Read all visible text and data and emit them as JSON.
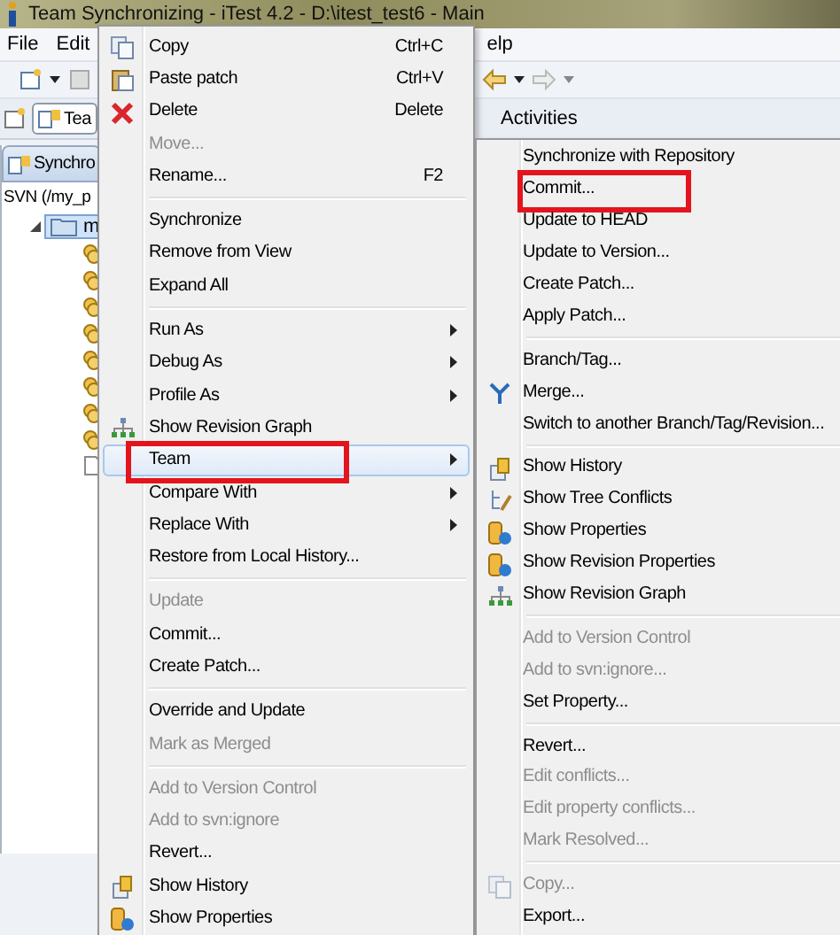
{
  "window": {
    "title": "Team Synchronizing - iTest 4.2 - D:\\itest_test6 - Main"
  },
  "menu_bar": [
    "File",
    "Edit",
    "elp"
  ],
  "perspective_bar": {
    "tab": "Tea",
    "label": "Activities"
  },
  "view": {
    "tab": "Synchro",
    "header": "SVN (/my_p",
    "tree": [
      {
        "kind": "folder",
        "label": "m",
        "expanded": true,
        "selected": true,
        "children": [
          {
            "kind": "package"
          },
          {
            "kind": "package"
          },
          {
            "kind": "package"
          },
          {
            "kind": "package"
          },
          {
            "kind": "package"
          },
          {
            "kind": "package"
          },
          {
            "kind": "package"
          },
          {
            "kind": "package"
          },
          {
            "kind": "file"
          }
        ]
      }
    ]
  },
  "context_menu": [
    {
      "kind": "copy",
      "label": "Copy",
      "shortcut": "Ctrl+C",
      "disabled": false,
      "submenu": false,
      "selected": false,
      "boxed": false
    },
    {
      "kind": "paste",
      "label": "Paste patch",
      "shortcut": "Ctrl+V",
      "disabled": false,
      "submenu": false,
      "selected": false,
      "boxed": false
    },
    {
      "kind": "delete",
      "label": "Delete",
      "shortcut": "Delete",
      "disabled": false,
      "submenu": false,
      "selected": false,
      "boxed": false
    },
    {
      "kind": "item",
      "label": "Move...",
      "disabled": true,
      "submenu": false,
      "selected": false,
      "boxed": false
    },
    {
      "kind": "item",
      "label": "Rename...",
      "shortcut": "F2",
      "disabled": false,
      "submenu": false,
      "selected": false,
      "boxed": false
    },
    {
      "kind": "separator"
    },
    {
      "kind": "item",
      "label": "Synchronize",
      "disabled": false,
      "submenu": false,
      "selected": false,
      "boxed": false
    },
    {
      "kind": "item",
      "label": "Remove from View",
      "disabled": false,
      "submenu": false,
      "selected": false,
      "boxed": false
    },
    {
      "kind": "item",
      "label": "Expand All",
      "disabled": false,
      "submenu": false,
      "selected": false,
      "boxed": false
    },
    {
      "kind": "separator"
    },
    {
      "kind": "item",
      "label": "Run As",
      "disabled": false,
      "submenu": true,
      "selected": false,
      "boxed": false
    },
    {
      "kind": "item",
      "label": "Debug As",
      "disabled": false,
      "submenu": true,
      "selected": false,
      "boxed": false
    },
    {
      "kind": "item",
      "label": "Profile As",
      "disabled": false,
      "submenu": true,
      "selected": false,
      "boxed": false
    },
    {
      "kind": "graph",
      "label": "Show Revision Graph",
      "disabled": false,
      "submenu": false,
      "selected": false,
      "boxed": false
    },
    {
      "kind": "item",
      "label": "Team",
      "disabled": false,
      "submenu": true,
      "selected": true,
      "boxed": true
    },
    {
      "kind": "item",
      "label": "Compare With",
      "disabled": false,
      "submenu": true,
      "selected": false,
      "boxed": false
    },
    {
      "kind": "item",
      "label": "Replace With",
      "disabled": false,
      "submenu": true,
      "selected": false,
      "boxed": false
    },
    {
      "kind": "item",
      "label": "Restore from Local History...",
      "disabled": false,
      "submenu": false,
      "selected": false,
      "boxed": false
    },
    {
      "kind": "separator"
    },
    {
      "kind": "item",
      "label": "Update",
      "disabled": true,
      "submenu": false,
      "selected": false,
      "boxed": false
    },
    {
      "kind": "item",
      "label": "Commit...",
      "disabled": false,
      "submenu": false,
      "selected": false,
      "boxed": false
    },
    {
      "kind": "item",
      "label": "Create Patch...",
      "disabled": false,
      "submenu": false,
      "selected": false,
      "boxed": false
    },
    {
      "kind": "separator"
    },
    {
      "kind": "item",
      "label": "Override and Update",
      "disabled": false,
      "submenu": false,
      "selected": false,
      "boxed": false
    },
    {
      "kind": "item",
      "label": "Mark as Merged",
      "disabled": true,
      "submenu": false,
      "selected": false,
      "boxed": false
    },
    {
      "kind": "separator"
    },
    {
      "kind": "item",
      "label": "Add to Version Control",
      "disabled": true,
      "submenu": false,
      "selected": false,
      "boxed": false
    },
    {
      "kind": "item",
      "label": "Add to svn:ignore",
      "disabled": true,
      "submenu": false,
      "selected": false,
      "boxed": false
    },
    {
      "kind": "item",
      "label": "Revert...",
      "disabled": false,
      "submenu": false,
      "selected": false,
      "boxed": false
    },
    {
      "kind": "history",
      "label": "Show History",
      "disabled": false,
      "submenu": false,
      "selected": false,
      "boxed": false
    },
    {
      "kind": "properties",
      "label": "Show Properties",
      "disabled": false,
      "submenu": false,
      "selected": false,
      "boxed": false
    }
  ],
  "team_submenu": [
    {
      "kind": "item",
      "label": "Synchronize with Repository",
      "disabled": false,
      "selected": false,
      "boxed": false
    },
    {
      "kind": "item",
      "label": "Commit...",
      "disabled": false,
      "selected": false,
      "boxed": true
    },
    {
      "kind": "item",
      "label": "Update to HEAD",
      "disabled": false,
      "selected": false,
      "boxed": false
    },
    {
      "kind": "item",
      "label": "Update to Version...",
      "disabled": false,
      "selected": false,
      "boxed": false
    },
    {
      "kind": "item",
      "label": "Create Patch...",
      "disabled": false,
      "selected": false,
      "boxed": false
    },
    {
      "kind": "item",
      "label": "Apply Patch...",
      "disabled": false,
      "selected": false,
      "boxed": false
    },
    {
      "kind": "separator"
    },
    {
      "kind": "item",
      "label": "Branch/Tag...",
      "disabled": false,
      "selected": false,
      "boxed": false
    },
    {
      "kind": "merge",
      "label": "Merge...",
      "disabled": false,
      "selected": false,
      "boxed": false
    },
    {
      "kind": "item",
      "label": "Switch to another Branch/Tag/Revision...",
      "disabled": false,
      "selected": false,
      "boxed": false
    },
    {
      "kind": "separator"
    },
    {
      "kind": "history",
      "label": "Show History",
      "disabled": false,
      "selected": false,
      "boxed": false
    },
    {
      "kind": "conflicts",
      "label": "Show Tree Conflicts",
      "disabled": false,
      "selected": false,
      "boxed": false
    },
    {
      "kind": "properties",
      "label": "Show Properties",
      "disabled": false,
      "selected": false,
      "boxed": false
    },
    {
      "kind": "properties",
      "label": "Show Revision Properties",
      "disabled": false,
      "selected": false,
      "boxed": false
    },
    {
      "kind": "graph",
      "label": "Show Revision Graph",
      "disabled": false,
      "selected": false,
      "boxed": false
    },
    {
      "kind": "separator"
    },
    {
      "kind": "item",
      "label": "Add to Version Control",
      "disabled": true,
      "selected": false,
      "boxed": false
    },
    {
      "kind": "item",
      "label": "Add to svn:ignore...",
      "disabled": true,
      "selected": false,
      "boxed": false
    },
    {
      "kind": "item",
      "label": "Set Property...",
      "disabled": false,
      "selected": false,
      "boxed": false
    },
    {
      "kind": "separator"
    },
    {
      "kind": "item",
      "label": "Revert...",
      "disabled": false,
      "selected": false,
      "boxed": false
    },
    {
      "kind": "item",
      "label": "Edit conflicts...",
      "disabled": true,
      "selected": false,
      "boxed": false
    },
    {
      "kind": "item",
      "label": "Edit property conflicts...",
      "disabled": true,
      "selected": false,
      "boxed": false
    },
    {
      "kind": "item",
      "label": "Mark Resolved...",
      "disabled": true,
      "selected": false,
      "boxed": false
    },
    {
      "kind": "separator"
    },
    {
      "kind": "copy",
      "label": "Copy...",
      "disabled": true,
      "selected": false,
      "boxed": false
    },
    {
      "kind": "item",
      "label": "Export...",
      "disabled": false,
      "selected": false,
      "boxed": false
    }
  ]
}
